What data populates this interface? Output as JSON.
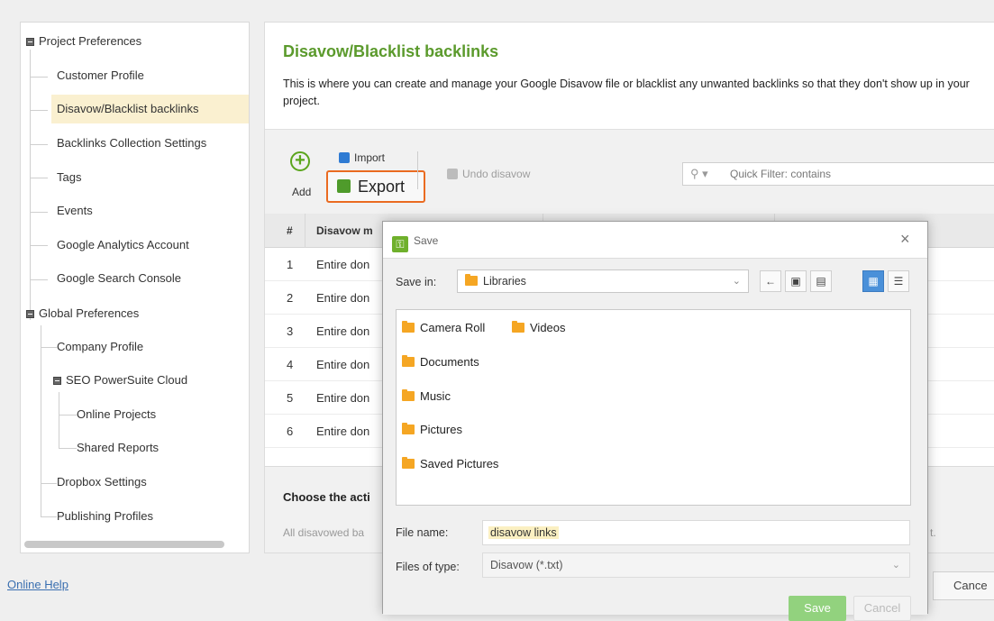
{
  "tree": {
    "project_preferences": "Project Preferences",
    "customer_profile": "Customer Profile",
    "disavow_blacklist": "Disavow/Blacklist backlinks",
    "backlinks_collection": "Backlinks Collection Settings",
    "tags": "Tags",
    "events": "Events",
    "google_analytics": "Google Analytics Account",
    "google_search_console": "Google Search Console",
    "global_preferences": "Global Preferences",
    "company_profile": "Company Profile",
    "seo_powersuite_cloud": "SEO PowerSuite Cloud",
    "online_projects": "Online Projects",
    "shared_reports": "Shared Reports",
    "dropbox_settings": "Dropbox Settings",
    "publishing_profiles": "Publishing Profiles"
  },
  "online_help": "Online Help",
  "main": {
    "title": "Disavow/Blacklist backlinks",
    "description": "This is where you can create and manage your Google Disavow file or blacklist any unwanted backlinks so that they don't show up in your project."
  },
  "toolbar": {
    "add": "Add",
    "import": "Import",
    "export": "Export",
    "undo": "Undo disavow",
    "filter_placeholder": "Quick Filter: contains"
  },
  "grid": {
    "col_num": "#",
    "col_mode": "Disavow m",
    "rows": [
      {
        "num": "1",
        "value": "Entire don"
      },
      {
        "num": "2",
        "value": "Entire don"
      },
      {
        "num": "3",
        "value": "Entire don"
      },
      {
        "num": "4",
        "value": "Entire don"
      },
      {
        "num": "5",
        "value": "Entire don"
      },
      {
        "num": "6",
        "value": "Entire don"
      }
    ]
  },
  "bottom": {
    "choose_action": "Choose the acti",
    "all_disavowed": "All disavowed ba",
    "trailing": "t.",
    "cancel": "Cance"
  },
  "dialog": {
    "title": "Save",
    "save_in_label": "Save in:",
    "save_in_value": "Libraries",
    "folders": [
      "Camera Roll",
      "Videos",
      "Documents",
      "Music",
      "Pictures",
      "Saved Pictures"
    ],
    "file_name_label": "File name:",
    "file_name_value": "disavow links",
    "files_of_type_label": "Files of type:",
    "files_of_type_value": "Disavow (*.txt)",
    "save": "Save",
    "cancel": "Cancel"
  },
  "colors": {
    "accent_green": "#5b9a2c",
    "export_highlight": "#ea6b21",
    "selected_row": "#faf0d0"
  }
}
